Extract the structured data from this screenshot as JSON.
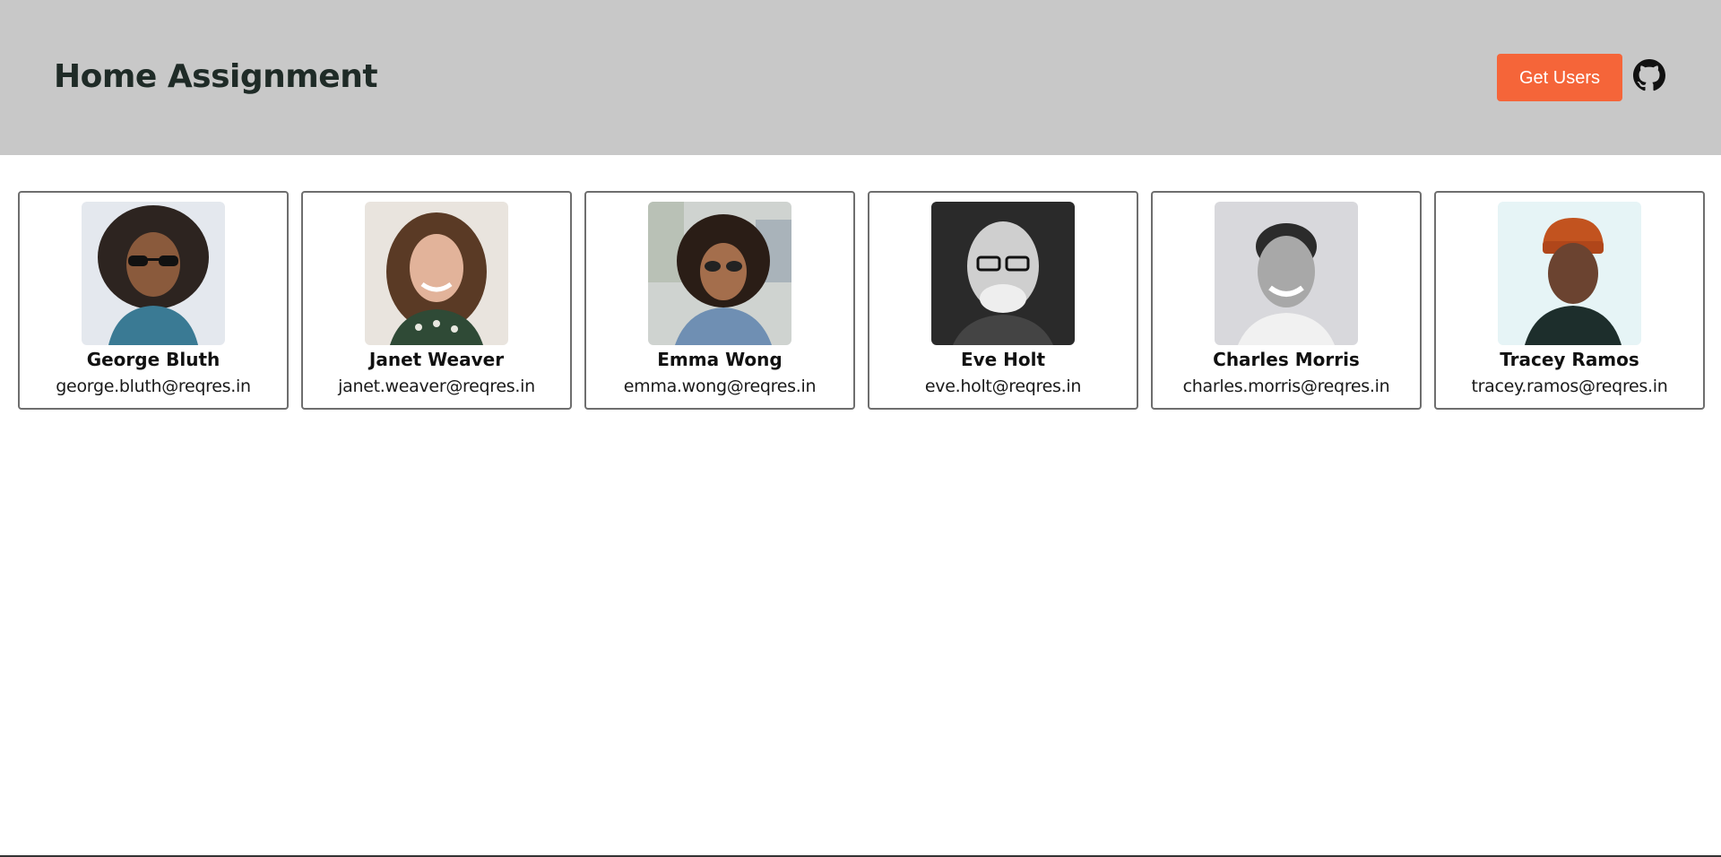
{
  "header": {
    "title": "Home Assignment",
    "get_users_label": "Get Users",
    "github_icon": "github-icon",
    "background_color": "#c8c8c8",
    "button_color": "#f56539"
  },
  "users": [
    {
      "name": "George Bluth",
      "email": "george.bluth@reqres.in",
      "avatar_icon": "avatar-photo"
    },
    {
      "name": "Janet Weaver",
      "email": "janet.weaver@reqres.in",
      "avatar_icon": "avatar-photo"
    },
    {
      "name": "Emma Wong",
      "email": "emma.wong@reqres.in",
      "avatar_icon": "avatar-photo"
    },
    {
      "name": "Eve Holt",
      "email": "eve.holt@reqres.in",
      "avatar_icon": "avatar-photo"
    },
    {
      "name": "Charles Morris",
      "email": "charles.morris@reqres.in",
      "avatar_icon": "avatar-photo"
    },
    {
      "name": "Tracey Ramos",
      "email": "tracey.ramos@reqres.in",
      "avatar_icon": "avatar-photo"
    }
  ]
}
